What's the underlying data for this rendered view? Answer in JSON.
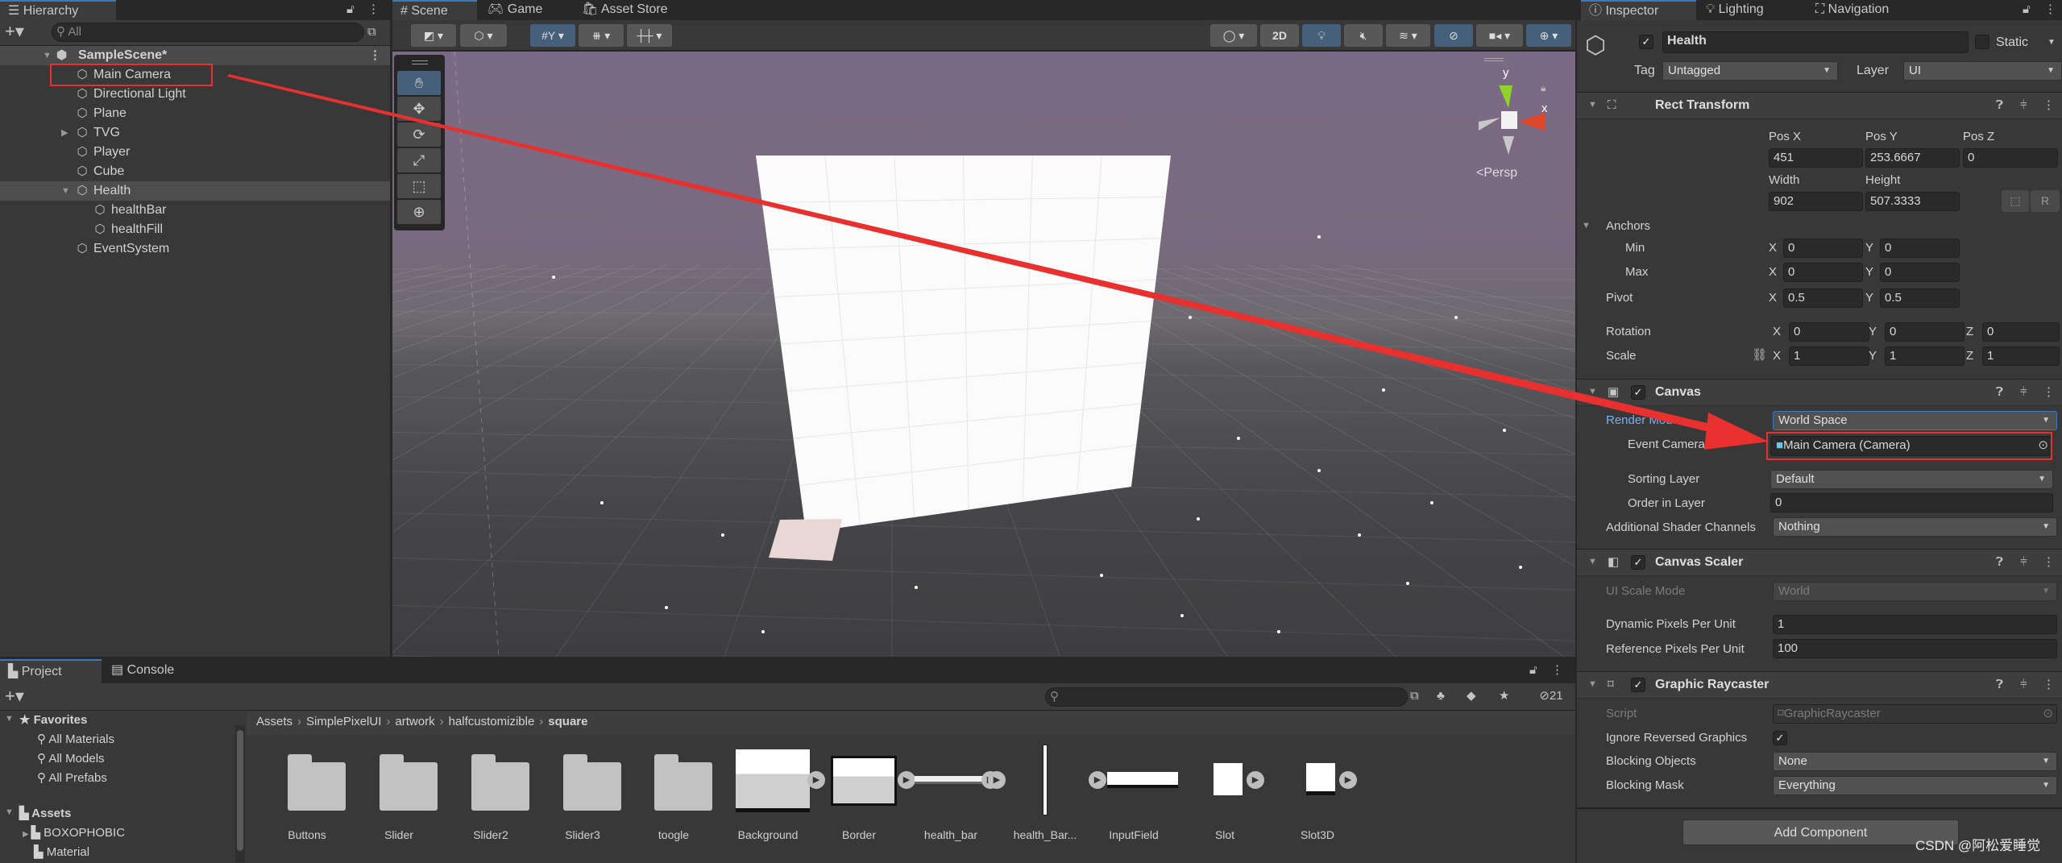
{
  "colors": {
    "accent": "#3a79bb",
    "highlight_red": "#e8302f",
    "selected_row": "#4d4d4d",
    "blue_toggle": "#46607c"
  },
  "hierarchy": {
    "tab": "Hierarchy",
    "search_placeholder": "All",
    "scene": "SampleScene*",
    "items": [
      {
        "label": "Main Camera",
        "depth": 1,
        "highlighted": true
      },
      {
        "label": "Directional Light",
        "depth": 1
      },
      {
        "label": "Plane",
        "depth": 1
      },
      {
        "label": "TVG",
        "depth": 1,
        "collapsed": true
      },
      {
        "label": "Player",
        "depth": 1
      },
      {
        "label": "Cube",
        "depth": 1
      },
      {
        "label": "Health",
        "depth": 1,
        "expanded": true,
        "selected": true
      },
      {
        "label": "healthBar",
        "depth": 2
      },
      {
        "label": "healthFill",
        "depth": 2
      },
      {
        "label": "EventSystem",
        "depth": 1
      }
    ]
  },
  "scene": {
    "tabs": [
      "Scene",
      "Game",
      "Asset Store"
    ],
    "two_d": "2D",
    "gizmo_y": "y",
    "gizmo_x": "x",
    "projection": "Persp",
    "tools": [
      "hand-icon",
      "move-icon",
      "rotate-icon",
      "scale-icon",
      "rect-tool-icon",
      "transform-icon"
    ]
  },
  "inspector": {
    "tabs": [
      "Inspector",
      "Lighting",
      "Navigation"
    ],
    "object_name": "Health",
    "active": true,
    "static_label": "Static",
    "tag_label": "Tag",
    "tag": "Untagged",
    "layer_label": "Layer",
    "layer": "UI",
    "rect": {
      "title": "Rect Transform",
      "pos_x_label": "Pos X",
      "pos_y_label": "Pos Y",
      "pos_z_label": "Pos Z",
      "pos_x": "451",
      "pos_y": "253.6667",
      "pos_z": "0",
      "width_label": "Width",
      "height_label": "Height",
      "width": "902",
      "height": "507.3333",
      "r_button": "R",
      "anchors": "Anchors",
      "min": "Min",
      "max": "Max",
      "pivot": "Pivot",
      "rotation": "Rotation",
      "scale": "Scale",
      "x": "X",
      "y": "Y",
      "z": "Z",
      "min_x": "0",
      "min_y": "0",
      "max_x": "0",
      "max_y": "0",
      "pivot_x": "0.5",
      "pivot_y": "0.5",
      "rot_x": "0",
      "rot_y": "0",
      "rot_z": "0",
      "scale_x": "1",
      "scale_y": "1",
      "scale_z": "1"
    },
    "canvas": {
      "title": "Canvas",
      "render_mode_label": "Render Mode",
      "render_mode": "World Space",
      "event_camera_label": "Event Camera",
      "event_camera": "Main Camera (Camera)",
      "sorting_layer_label": "Sorting Layer",
      "sorting_layer": "Default",
      "order_label": "Order in Layer",
      "order": "0",
      "shader_label": "Additional Shader Channels",
      "shader": "Nothing"
    },
    "scaler": {
      "title": "Canvas Scaler",
      "mode_label": "UI Scale Mode",
      "mode": "World",
      "dynamic_label": "Dynamic Pixels Per Unit",
      "dynamic": "1",
      "reference_label": "Reference Pixels Per Unit",
      "reference": "100"
    },
    "raycaster": {
      "title": "Graphic Raycaster",
      "script_label": "Script",
      "script": "GraphicRaycaster",
      "ignore_label": "Ignore Reversed Graphics",
      "ignore": true,
      "blocking_objects_label": "Blocking Objects",
      "blocking_objects": "None",
      "blocking_mask_label": "Blocking Mask",
      "blocking_mask": "Everything"
    },
    "add_component": "Add Component"
  },
  "project": {
    "tabs": [
      "Project",
      "Console"
    ],
    "hidden_count": "21",
    "favorites": {
      "label": "Favorites",
      "items": [
        "All Materials",
        "All Models",
        "All Prefabs"
      ]
    },
    "assets": {
      "label": "Assets",
      "items": [
        "BOXOPHOBIC",
        "Material"
      ]
    },
    "breadcrumb": [
      "Assets",
      "SimplePixelUI",
      "artwork",
      "halfcustomizible",
      "square"
    ],
    "files": [
      {
        "name": "Buttons",
        "kind": "folder"
      },
      {
        "name": "Slider",
        "kind": "folder"
      },
      {
        "name": "Slider2",
        "kind": "folder"
      },
      {
        "name": "Slider3",
        "kind": "folder"
      },
      {
        "name": "toogle",
        "kind": "folder"
      },
      {
        "name": "Background",
        "kind": "sprite-tall"
      },
      {
        "name": "Border",
        "kind": "sprite-box"
      },
      {
        "name": "health_bar",
        "kind": "sprite-bar"
      },
      {
        "name": "health_Bar...",
        "kind": "sprite-line"
      },
      {
        "name": "InputField",
        "kind": "sprite-input"
      },
      {
        "name": "Slot",
        "kind": "sprite-slot"
      },
      {
        "name": "Slot3D",
        "kind": "sprite-slot3d"
      }
    ]
  },
  "watermark": "CSDN @阿松爱睡觉"
}
